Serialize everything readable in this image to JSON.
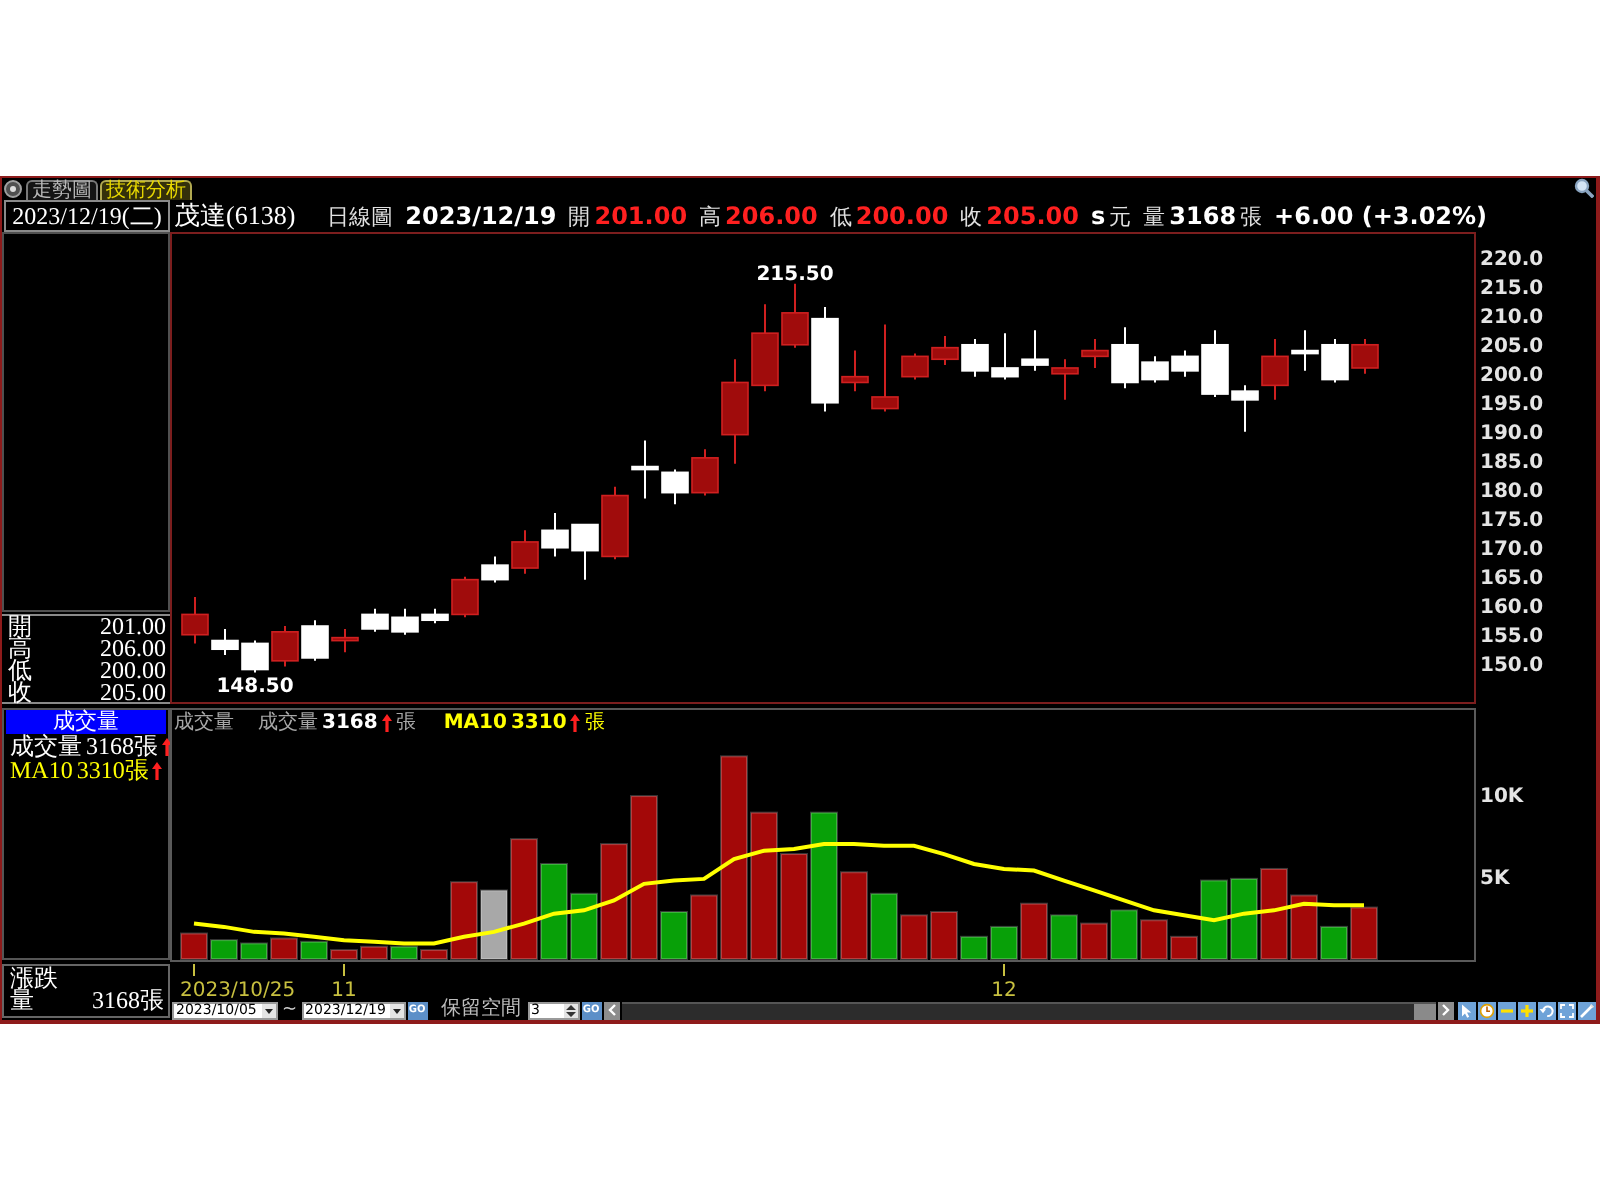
{
  "tabs": [
    {
      "label": "走勢圖",
      "selected": false
    },
    {
      "label": "技術分析",
      "selected": true
    }
  ],
  "date_box": "2023/12/19(二)",
  "header": {
    "stock": "茂達(6138)",
    "period": "日線圖",
    "date": "2023/12/19",
    "quotes": [
      {
        "label": "開",
        "value": "201.00",
        "kind": "price"
      },
      {
        "label": "高",
        "value": "206.00",
        "kind": "price"
      },
      {
        "label": "低",
        "value": "200.00",
        "kind": "price"
      },
      {
        "label": "收",
        "value": "205.00",
        "kind": "price"
      }
    ],
    "currency_mark": "s",
    "currency": "元",
    "volume": {
      "label": "量",
      "value": "3168",
      "unit": "張"
    },
    "change": "+6.00 (+3.02%)"
  },
  "ohlc": [
    {
      "label": "開",
      "value": "201.00"
    },
    {
      "label": "高",
      "value": "206.00"
    },
    {
      "label": "低",
      "value": "200.00"
    },
    {
      "label": "收",
      "value": "205.00"
    }
  ],
  "volume_panel": {
    "title": "成交量",
    "rows": [
      {
        "kind": "volume",
        "label": "成交量",
        "value": "3168張",
        "rising": true
      },
      {
        "kind": "average",
        "label": "MA10",
        "value": "3310張",
        "rising": true
      }
    ]
  },
  "summary": {
    "title": "漲跌",
    "label": "量",
    "value": "3168張"
  },
  "price_chart": {
    "high_label": "215.50",
    "low_label": "148.50",
    "chart_data": {
      "type": "candlestick",
      "ohlc": [
        [
          155,
          161.5,
          153.5,
          158.5
        ],
        [
          154,
          156,
          151.5,
          152.5
        ],
        [
          153.5,
          154,
          148.5,
          149
        ],
        [
          150.5,
          156.5,
          149.5,
          155.5
        ],
        [
          156.5,
          157.5,
          150.5,
          151
        ],
        [
          154,
          156,
          152,
          154.5
        ],
        [
          158.5,
          159.5,
          155.5,
          156
        ],
        [
          158,
          159.5,
          155,
          155.5
        ],
        [
          158.5,
          159.5,
          157,
          157.5
        ],
        [
          158.5,
          165,
          158,
          164.5
        ],
        [
          167,
          168.5,
          164,
          164.5
        ],
        [
          166.5,
          173,
          165.5,
          171
        ],
        [
          173,
          176,
          168.5,
          170
        ],
        [
          174,
          174,
          164.5,
          169.5
        ],
        [
          168.5,
          180.5,
          168,
          179
        ],
        [
          184,
          188.5,
          178.5,
          183.5
        ],
        [
          183,
          183.5,
          177.5,
          179.5
        ],
        [
          179.5,
          187,
          179,
          185.5
        ],
        [
          189.5,
          202.5,
          184.5,
          198.5
        ],
        [
          198,
          212,
          197,
          207
        ],
        [
          205,
          215.5,
          204.5,
          210.5
        ],
        [
          209.5,
          211.5,
          193.5,
          195
        ],
        [
          198.5,
          204,
          197,
          199.5
        ],
        [
          194,
          208.5,
          193.5,
          196
        ],
        [
          199.5,
          203.5,
          199,
          203
        ],
        [
          202.5,
          206.5,
          201.5,
          204.5
        ],
        [
          205,
          206,
          199.5,
          200.5
        ],
        [
          201,
          207,
          199,
          199.5
        ],
        [
          202.5,
          207.5,
          200.5,
          201.5
        ],
        [
          200,
          202.5,
          195.5,
          201
        ],
        [
          203,
          206,
          201,
          204
        ],
        [
          205,
          208,
          197.5,
          198.5
        ],
        [
          202,
          203,
          198.5,
          199
        ],
        [
          203,
          204,
          199.5,
          200.5
        ],
        [
          205,
          207.5,
          196,
          196.5
        ],
        [
          197,
          198,
          190,
          195.5
        ],
        [
          198,
          206,
          195.5,
          203
        ],
        [
          204,
          207.5,
          200.5,
          203.5
        ],
        [
          205,
          206,
          198.5,
          199
        ],
        [
          201,
          206,
          200,
          205
        ]
      ],
      "ylim": [
        143.4,
        224.1
      ],
      "yticks": [
        {
          "value": 220,
          "label": "220.0"
        },
        {
          "value": 215,
          "label": "215.0"
        },
        {
          "value": 210,
          "label": "210.0"
        },
        {
          "value": 205,
          "label": "205.0"
        },
        {
          "value": 200,
          "label": "200.0"
        },
        {
          "value": 195,
          "label": "195.0"
        },
        {
          "value": 190,
          "label": "190.0"
        },
        {
          "value": 185,
          "label": "185.0"
        },
        {
          "value": 180,
          "label": "180.0"
        },
        {
          "value": 175,
          "label": "175.0"
        },
        {
          "value": 170,
          "label": "170.0"
        },
        {
          "value": 165,
          "label": "165.0"
        },
        {
          "value": 160,
          "label": "160.0"
        },
        {
          "value": 155,
          "label": "155.0"
        },
        {
          "value": 150,
          "label": "150.0"
        }
      ]
    }
  },
  "volume_chart": {
    "legend": [
      {
        "label": "成交量",
        "value": "3168",
        "unit": "張",
        "rising": true
      },
      {
        "value": "3310",
        "unit": "張",
        "rising": true
      }
    ],
    "chart_data": {
      "type": "bar",
      "title": "成交量",
      "series": [
        {
          "colors": [
            "#a30808",
            "#08a008",
            "#08a008",
            "#a30808",
            "#08a008",
            "#a30808",
            "#a30808",
            "#08a008",
            "#a30808",
            "#a30808",
            "#a8a8a8",
            "#a30808",
            "#08a008",
            "#08a008",
            "#a30808",
            "#a30808",
            "#08a008",
            "#a30808",
            "#a30808",
            "#a30808",
            "#a30808",
            "#08a008",
            "#a30808",
            "#08a008",
            "#a30808",
            "#a30808",
            "#08a008",
            "#08a008",
            "#a30808",
            "#08a008",
            "#a30808",
            "#08a008",
            "#a30808",
            "#a30808",
            "#08a008",
            "#08a008",
            "#a30808",
            "#a30808",
            "#08a008",
            "#a30808"
          ],
          "values": [
            1600,
            1200,
            1000,
            1300,
            1100,
            600,
            800,
            800,
            600,
            4700,
            4200,
            7300,
            5800,
            4000,
            7000,
            9900,
            2900,
            3900,
            12300,
            8900,
            6400,
            8900,
            5300,
            4000,
            2700,
            2900,
            1400,
            2000,
            3400,
            2700,
            2200,
            3000,
            2400,
            1400,
            4800,
            4900,
            5500,
            3900,
            2000,
            3168
          ]
        },
        {
          "name": "MA10",
          "type": "line",
          "color": "#ffff00",
          "values": [
            2200,
            2000,
            1700,
            1600,
            1400,
            1200,
            1100,
            1000,
            1000,
            1400,
            1700,
            2200,
            2800,
            3000,
            3600,
            4600,
            4800,
            4900,
            6100,
            6600,
            6700,
            7000,
            7000,
            6900,
            6900,
            6400,
            5800,
            5500,
            5400,
            4800,
            4200,
            3600,
            3000,
            2700,
            2400,
            2800,
            3000,
            3400,
            3300,
            3310
          ]
        }
      ],
      "ylim": [
        0,
        15100
      ],
      "yticks": [
        {
          "value": 10000,
          "label": "10K"
        },
        {
          "value": 5000,
          "label": "5K"
        }
      ]
    }
  },
  "date_axis": [
    "2023/10/25",
    "11",
    "12"
  ],
  "toolbar": {
    "start_date": "2023/10/05",
    "separator": "~",
    "end_date": "2023/12/19",
    "apply_button": "GO",
    "space_label": "保留空間",
    "space_value": "3",
    "space_button": "GO"
  }
}
